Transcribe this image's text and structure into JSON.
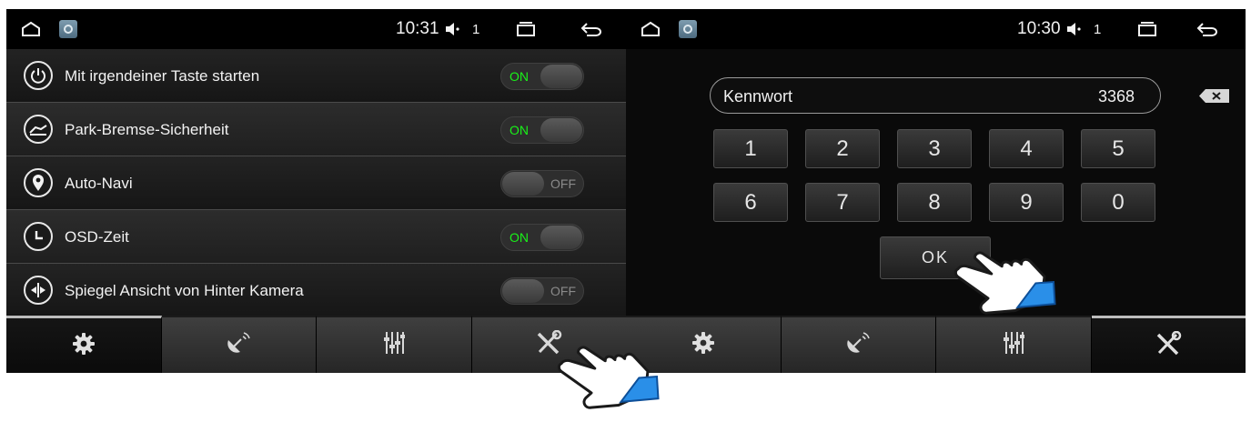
{
  "left_screen": {
    "status_bar": {
      "time": "10:31",
      "volume_count": "1"
    },
    "settings": [
      {
        "label": "Mit irgendeiner Taste starten",
        "icon": "power-icon",
        "state": "ON"
      },
      {
        "label": "Park-Bremse-Sicherheit",
        "icon": "parking-brake-icon",
        "state": "ON"
      },
      {
        "label": "Auto-Navi",
        "icon": "location-pin-icon",
        "state": "OFF"
      },
      {
        "label": "OSD-Zeit",
        "icon": "clock-icon",
        "state": "ON"
      },
      {
        "label": "Spiegel Ansicht von Hinter Kamera",
        "icon": "mirror-icon",
        "state": "OFF"
      }
    ],
    "tabs": [
      {
        "icon": "gear-icon",
        "active": true
      },
      {
        "icon": "satellite-icon",
        "active": false
      },
      {
        "icon": "equalizer-icon",
        "active": false
      },
      {
        "icon": "tools-icon",
        "active": false
      }
    ]
  },
  "right_screen": {
    "status_bar": {
      "time": "10:30",
      "volume_count": "1"
    },
    "password": {
      "label": "Kennwort",
      "value": "3368"
    },
    "keypad": [
      "1",
      "2",
      "3",
      "4",
      "5",
      "6",
      "7",
      "8",
      "9",
      "0"
    ],
    "ok_label": "OK",
    "tabs": [
      {
        "icon": "gear-icon",
        "active": false
      },
      {
        "icon": "satellite-icon",
        "active": false
      },
      {
        "icon": "equalizer-icon",
        "active": false
      },
      {
        "icon": "tools-icon",
        "active": true
      }
    ]
  },
  "colors": {
    "on_text": "#19f219",
    "off_text": "#8a8a8a",
    "hand_cuff": "#2a8fe8"
  }
}
